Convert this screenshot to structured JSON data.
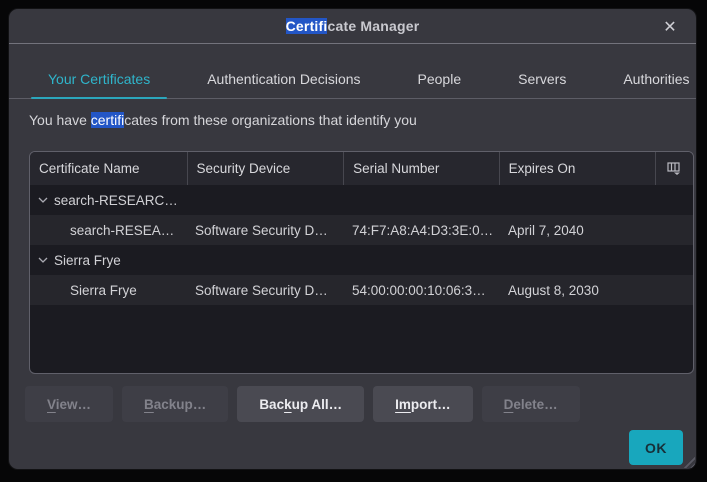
{
  "window": {
    "title": {
      "pre": "",
      "highlight": "Certifi",
      "post": "cate Manager"
    },
    "close_label": "✕"
  },
  "tabs": [
    {
      "label": "Your Certificates",
      "active": true
    },
    {
      "label": "Authentication Decisions",
      "active": false
    },
    {
      "label": "People",
      "active": false
    },
    {
      "label": "Servers",
      "active": false
    },
    {
      "label": "Authorities",
      "active": false
    }
  ],
  "intro": {
    "pre": "You have ",
    "highlight": "certifi",
    "post": "cates from these organizations that identify you"
  },
  "table": {
    "columns": [
      "Certificate Name",
      "Security Device",
      "Serial Number",
      "Expires On"
    ],
    "column_picker_icon": "column-picker",
    "rows": [
      {
        "type": "group",
        "name": "search-RESEARC…"
      },
      {
        "type": "leaf",
        "name": "search-RESEA…",
        "device": "Software Security D…",
        "serial": "74:F7:A8:A4:D3:3E:0…",
        "expires": "April 7, 2040"
      },
      {
        "type": "group",
        "name": "Sierra Frye"
      },
      {
        "type": "leaf",
        "name": "Sierra Frye",
        "device": "Software Security D…",
        "serial": "54:00:00:00:10:06:3…",
        "expires": "August 8, 2030"
      }
    ]
  },
  "buttons": [
    {
      "pre": "",
      "key": "V",
      "post": "iew…",
      "enabled": false
    },
    {
      "pre": "",
      "key": "B",
      "post": "ackup…",
      "enabled": false
    },
    {
      "pre": "Bac",
      "key": "k",
      "post": "up All…",
      "enabled": true
    },
    {
      "pre": "",
      "key": "Im",
      "post": "port…",
      "enabled": true
    },
    {
      "pre": "",
      "key": "D",
      "post": "elete…",
      "enabled": false
    }
  ],
  "ok_button": {
    "label": "OK"
  },
  "colors": {
    "accent_teal": "#2fb5cb",
    "tab_underline": "#2ba6bc",
    "find_highlight": "#2356c6",
    "ok_background": "#18a7bd",
    "dialog_background": "#38383f",
    "row_dark": "#1b1b21",
    "row_light": "#26262c"
  }
}
